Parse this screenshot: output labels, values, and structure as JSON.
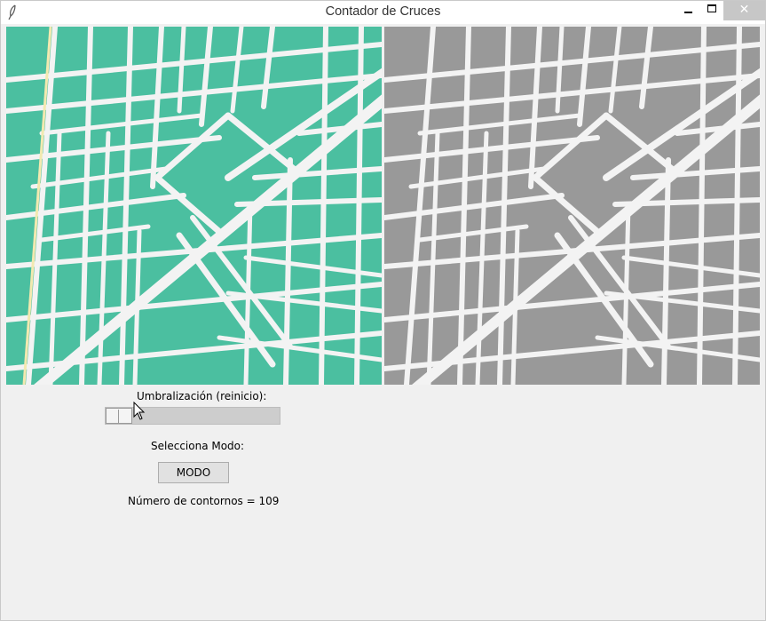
{
  "window": {
    "title": "Contador de Cruces",
    "controls": {
      "minimize": "minimize-icon",
      "maximize": "maximize-icon",
      "close": "close-icon",
      "close_glyph": "✕"
    }
  },
  "images": {
    "left": {
      "description_icon": "map-image",
      "fill_color": "#4bbfa0",
      "road_color": "#f3f3f3"
    },
    "right": {
      "description_icon": "map-image",
      "fill_color": "#999999",
      "road_color": "#f3f3f3"
    }
  },
  "threshold": {
    "label": "Umbralización (reinicio):",
    "value_fraction": 0.0
  },
  "mode": {
    "label": "Selecciona Modo:",
    "button_label": "MODO"
  },
  "result": {
    "count_text": "Número de contornos = 109"
  }
}
